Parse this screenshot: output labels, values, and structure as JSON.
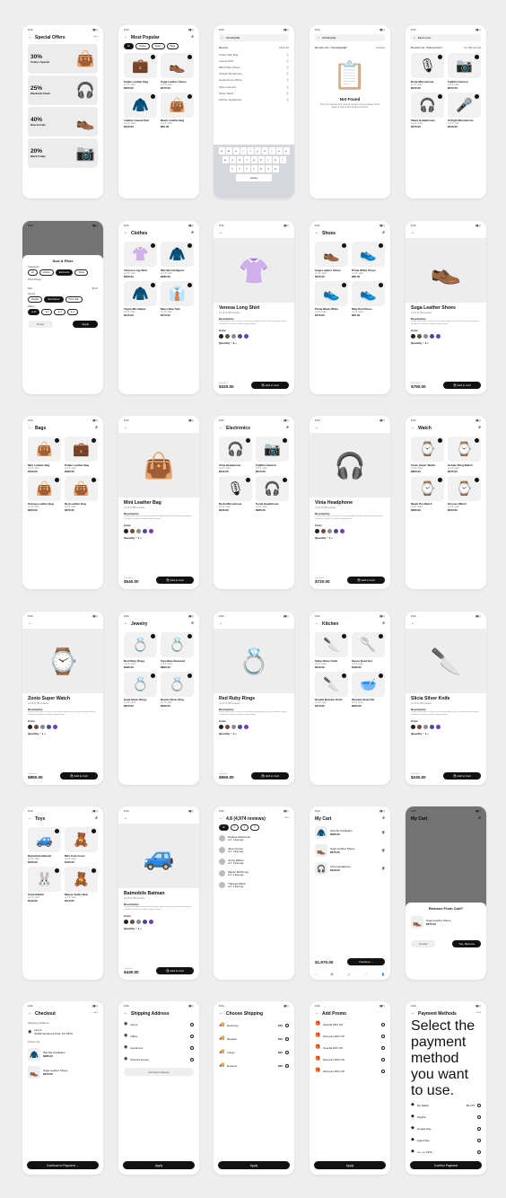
{
  "status_time": "9:41",
  "offers": {
    "title": "Special Offers",
    "items": [
      {
        "pct": "30%",
        "name": "Today's Special",
        "icon": "👜"
      },
      {
        "pct": "25%",
        "name": "Weekends Deals",
        "icon": "🎧"
      },
      {
        "pct": "40%",
        "name": "New Arrivals",
        "icon": "👞"
      },
      {
        "pct": "20%",
        "name": "Black Friday",
        "icon": "📷"
      }
    ]
  },
  "popular": {
    "title": "Most Popular",
    "chips": [
      "All",
      "Clothes",
      "Shoes",
      "Bags"
    ],
    "items": [
      {
        "name": "Snake Leather Bag",
        "price": "$460.00",
        "icon": "💼"
      },
      {
        "name": "Suga Leather Shoes",
        "price": "$375.00",
        "icon": "👞"
      },
      {
        "name": "Leather Casual Suit",
        "price": "$420.00",
        "icon": "🧥"
      },
      {
        "name": "Black Leather Bag",
        "price": "$60.00",
        "icon": "👜"
      }
    ]
  },
  "search": {
    "placeholder": "Abcdefghijk",
    "recent_label": "Recent",
    "clear": "Clear All",
    "items": [
      "Snake Skin Bag",
      "Casual Shirt",
      "Black Nike Shoes",
      "Airfight Microphone",
      "Headphones White",
      "Nikon Camera",
      "Silver Watch",
      "Kitchen Appliances"
    ],
    "keys1": [
      "q",
      "w",
      "e",
      "r",
      "t",
      "y",
      "u",
      "i",
      "o",
      "p"
    ],
    "keys2": [
      "a",
      "s",
      "d",
      "f",
      "g",
      "h",
      "j",
      "k",
      "l"
    ],
    "keys3": [
      "z",
      "x",
      "c",
      "v",
      "b",
      "n",
      "m"
    ],
    "space": "space"
  },
  "notfound": {
    "query": "Abcdefghijk",
    "results": "Results for \"Abcdefghijk\"",
    "count": "0 found",
    "title": "Not Found",
    "text": "Sorry, the keyword you entered cannot be found, please check again or search with another keyword."
  },
  "results": {
    "query": "Electronics",
    "results": "Results for \"Electronics\"",
    "count": "12,799 founds",
    "items": [
      {
        "name": "Rode Microphone",
        "price": "$240.00",
        "icon": "🎙"
      },
      {
        "name": "Fujifilm Camera",
        "price": "$670.00",
        "icon": "📷"
      },
      {
        "name": "Silent Headphones",
        "price": "$275.00",
        "icon": "🎧"
      },
      {
        "name": "Airfight Microphone",
        "price": "$310.00",
        "icon": "🎤"
      }
    ]
  },
  "filter": {
    "title": "Sort & Filter",
    "categories_label": "Categories",
    "categories": [
      "All",
      "Clothes",
      "Electronics",
      "Shoes"
    ],
    "price_label": "Price Range",
    "price_min": "$20",
    "price_max": "$120",
    "sort_label": "Sort by",
    "sorts": [
      "Popular",
      "Most Recent",
      "Price High"
    ],
    "rating_label": "Rating",
    "ratings": [
      "All",
      "5",
      "4",
      "3"
    ],
    "reset": "Reset",
    "apply": "Apply"
  },
  "clothes": {
    "title": "Clothes",
    "items": [
      {
        "name": "Venesa Long Shirt",
        "price": "$320.00",
        "icon": "👚"
      },
      {
        "name": "Werolla Cardigans",
        "price": "$385.00",
        "icon": "🧥"
      },
      {
        "name": "Viyara Mix Blazer",
        "price": "$315.00",
        "icon": "🧥"
      },
      {
        "name": "Maco Blue Suit",
        "price": "$270.00",
        "icon": "👔"
      }
    ]
  },
  "shirt": {
    "name": "Venesa Long Shirt",
    "sold": "4,748 sold",
    "rating": "4.8 (6,768 reviews)",
    "desc_label": "Description",
    "desc": "Lorem ipsum dolor sit amet consectetur adipiscing elit sed do eiusmod tempor incididunt ut labore et dolore magna aliqua.",
    "size_label": "Size",
    "sizes": [
      "S",
      "M",
      "L"
    ],
    "color_label": "Color",
    "qty_label": "Quantity",
    "qty": "2",
    "total_label": "Total price",
    "price": "$320.00",
    "cta": "Add to Cart",
    "icon": "👚"
  },
  "shoes": {
    "title": "Shoes",
    "items": [
      {
        "name": "Suga Leather Shoes",
        "price": "$375.00",
        "icon": "👞"
      },
      {
        "name": "Puma White Shoes",
        "price": "$80.00",
        "icon": "👟"
      },
      {
        "name": "Puma Black White",
        "price": "$470.00",
        "icon": "👟"
      },
      {
        "name": "Nike Red Shoes",
        "price": "$60.00",
        "icon": "👟"
      }
    ]
  },
  "shoe": {
    "name": "Suga Leather Shoes",
    "rating": "4.8 (6,768 reviews)",
    "qty": "2",
    "price": "$750.00",
    "cta": "Add to Cart",
    "icon": "👞"
  },
  "bags": {
    "title": "Bags",
    "items": [
      {
        "name": "Mini Leather Bag",
        "price": "$540.00",
        "icon": "👜"
      },
      {
        "name": "Snake Leather Bag",
        "price": "$485.00",
        "icon": "💼"
      },
      {
        "name": "Orange Leather Bag",
        "price": "$295.00",
        "icon": "👜"
      },
      {
        "name": "Red Leather Bag",
        "price": "$375.00",
        "icon": "👜"
      }
    ]
  },
  "bag": {
    "name": "Mini Leather Bag",
    "rating": "4.8 (6,768 reviews)",
    "qty": "1",
    "price": "$540.00",
    "cta": "Add to Cart",
    "icon": "👜"
  },
  "electronics": {
    "title": "Electronics",
    "items": [
      {
        "name": "Vinia Headphone",
        "price": "$240.00",
        "icon": "🎧"
      },
      {
        "name": "Fujifilm Camera",
        "price": "$670.00",
        "icon": "📷"
      },
      {
        "name": "Rode Microphone",
        "price": "$246.00",
        "icon": "🎙"
      },
      {
        "name": "Sonia Headphone",
        "price": "$285.00",
        "icon": "🎧"
      }
    ]
  },
  "headphone": {
    "name": "Vinia Headphone",
    "rating": "4.8 (6,768 reviews)",
    "qty": "1",
    "price": "$720.00",
    "cta": "Add to Cart",
    "icon": "🎧"
  },
  "watch": {
    "title": "Watch",
    "items": [
      {
        "name": "Zonio Super Watch",
        "price": "$850.00",
        "icon": "⌚"
      },
      {
        "name": "Golden Ring Watch",
        "price": "$375.00",
        "icon": "⌚"
      },
      {
        "name": "Black Pro Watch",
        "price": "$280.00",
        "icon": "⌚"
      },
      {
        "name": "Glossio Watch",
        "price": "$640.00",
        "icon": "⌚"
      }
    ]
  },
  "watchd": {
    "name": "Zonio Super Watch",
    "rating": "4.8 (6,768 reviews)",
    "qty": "1",
    "price": "$850.00",
    "cta": "Add to Cart",
    "icon": "⌚"
  },
  "jewelry": {
    "title": "Jewelry",
    "items": [
      {
        "name": "Red Ruby Rings",
        "price": "$480.00",
        "icon": "💍"
      },
      {
        "name": "Viya Blue Diamond",
        "price": "$880.00",
        "icon": "💍"
      },
      {
        "name": "Hujai Silver Rings",
        "price": "$870.00",
        "icon": "💍"
      },
      {
        "name": "Bramo Silver Ring",
        "price": "$395.00",
        "icon": "💍"
      }
    ]
  },
  "ring": {
    "name": "Red Ruby Rings",
    "rating": "4.8 (6,768 reviews)",
    "qty": "2",
    "price": "$960.00",
    "cta": "Add to Cart",
    "icon": "💍"
  },
  "kitchen": {
    "title": "Kitchen",
    "items": [
      {
        "name": "Slicia Silver Knife",
        "price": "$240.00",
        "icon": "🔪"
      },
      {
        "name": "Spoon Bowl Set",
        "price": "$180.00",
        "icon": "🥄"
      },
      {
        "name": "Double Butcher Knife",
        "price": "$470.00",
        "icon": "🔪"
      },
      {
        "name": "Wooden Bowl Set",
        "price": "$265.00",
        "icon": "🥣"
      }
    ]
  },
  "knife": {
    "name": "Slicia Silver Knife",
    "rating": "4.8 (6,768 reviews)",
    "qty": "1",
    "price": "$240.00",
    "cta": "Add to Cart",
    "icon": "🔪"
  },
  "toys": {
    "title": "Toys",
    "items": [
      {
        "name": "Batmobile Batman",
        "price": "$430.00",
        "icon": "🚙"
      },
      {
        "name": "Mini Cute Groot",
        "price": "$120.00",
        "icon": "🧸"
      },
      {
        "name": "Cutie Rabbit",
        "price": "$140.00",
        "icon": "🐰"
      },
      {
        "name": "Manya Teddy Bear",
        "price": "$110.00",
        "icon": "🧸"
      }
    ]
  },
  "batmobile": {
    "name": "Batmobile Batman",
    "rating": "4.8 (6,768 reviews)",
    "qty": "1",
    "price": "$430.00",
    "cta": "Add to Cart",
    "icon": "🚙"
  },
  "reviews": {
    "title": "4.8 (4,974 reviews)",
    "chips": [
      "All",
      "5",
      "4",
      "3"
    ],
    "items": [
      {
        "name": "Darlene Robertson",
        "ago": "6 days ago"
      },
      {
        "name": "Jane Cooper",
        "ago": "6 days ago"
      },
      {
        "name": "Jenny Wilson",
        "ago": "6 days ago"
      },
      {
        "name": "Marvin McKinney",
        "ago": "6 days ago"
      },
      {
        "name": "Theresa Webb",
        "ago": "6 days ago"
      }
    ]
  },
  "cart": {
    "title": "My Cart",
    "items": [
      {
        "name": "Werolla Cardigans",
        "price": "$385.00",
        "icon": "🧥"
      },
      {
        "name": "Suga Leather Shoes",
        "price": "$375.00",
        "icon": "👞"
      },
      {
        "name": "Vinia Headphone",
        "price": "$240.00",
        "icon": "🎧"
      }
    ],
    "total": "$1,970.00",
    "cta": "Checkout"
  },
  "remove": {
    "title": "Remove From Cart?",
    "item": "Suga Leather Shoes",
    "price": "$375.00",
    "cancel": "Cancel",
    "confirm": "Yes, Remove"
  },
  "checkout": {
    "title": "Checkout",
    "addr_label": "Shipping Address",
    "addr": "Home",
    "addr_sub": "61480 Sunbrook Park, PC 5679",
    "order_label": "Order List",
    "items": [
      {
        "name": "Werolla Cardigans",
        "price": "$385.00",
        "icon": "🧥"
      },
      {
        "name": "Suga Leather Shoes",
        "price": "$375.00",
        "icon": "👞"
      }
    ],
    "cta": "Continue to Payment"
  },
  "shipaddr": {
    "title": "Shipping Address",
    "items": [
      "Home",
      "Office",
      "Apartment",
      "Parent's House"
    ],
    "add": "Add New Address",
    "cta": "Apply"
  },
  "shipping": {
    "title": "Choose Shipping",
    "items": [
      {
        "name": "Economy",
        "price": "$10"
      },
      {
        "name": "Regular",
        "price": "$15"
      },
      {
        "name": "Cargo",
        "price": "$20"
      },
      {
        "name": "Express",
        "price": "$30"
      }
    ],
    "cta": "Apply"
  },
  "promo": {
    "title": "Add Promo",
    "items": [
      "Special 25% Off",
      "Discount 30% Off",
      "Special 20% Off",
      "Discount 40% Off",
      "Discount 35% Off"
    ],
    "cta": "Apply"
  },
  "payment": {
    "title": "Payment Methods",
    "sub": "Select the payment method you want to use.",
    "items": [
      {
        "name": "My Wallet",
        "amt": "$9,379"
      },
      {
        "name": "PayPal",
        "amt": ""
      },
      {
        "name": "Google Pay",
        "amt": ""
      },
      {
        "name": "Apple Pay",
        "amt": ""
      },
      {
        "name": "•••• •••• 4679",
        "amt": ""
      }
    ],
    "cta": "Confirm Payment"
  },
  "colors": [
    "#222222",
    "#6b4b3a",
    "#8b8b8b",
    "#4a4a88",
    "#6d3fb5"
  ]
}
